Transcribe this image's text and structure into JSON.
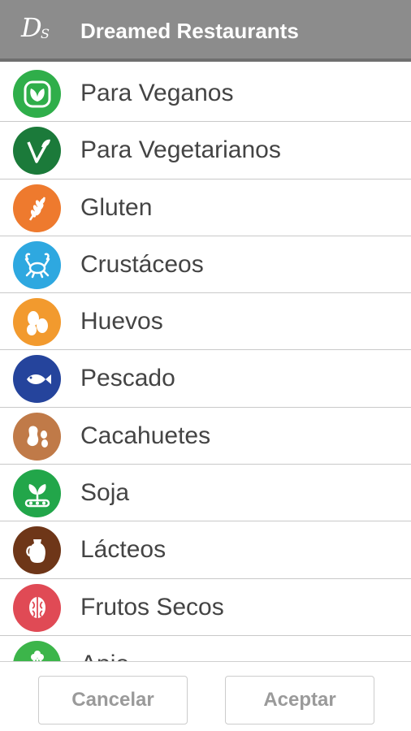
{
  "app": {
    "logo_d": "D",
    "logo_s": "S",
    "title": "Dreamed Restaurants"
  },
  "items": [
    {
      "label": "Para Veganos",
      "icon": "vegan-leaf-icon",
      "color": "#2fae4a"
    },
    {
      "label": "Para Vegetarianos",
      "icon": "vegetarian-v-icon",
      "color": "#1b7a3a"
    },
    {
      "label": "Gluten",
      "icon": "wheat-icon",
      "color": "#ee7a2e"
    },
    {
      "label": "Crustáceos",
      "icon": "crab-icon",
      "color": "#2ea8e0"
    },
    {
      "label": "Huevos",
      "icon": "eggs-icon",
      "color": "#f29a2e"
    },
    {
      "label": "Pescado",
      "icon": "fish-icon",
      "color": "#25449c"
    },
    {
      "label": "Cacahuetes",
      "icon": "peanut-icon",
      "color": "#c07a48"
    },
    {
      "label": "Soja",
      "icon": "soy-icon",
      "color": "#22a64a"
    },
    {
      "label": "Lácteos",
      "icon": "milk-jug-icon",
      "color": "#6e3618"
    },
    {
      "label": "Frutos Secos",
      "icon": "walnut-icon",
      "color": "#e04a55"
    },
    {
      "label": "Apio",
      "icon": "celery-icon",
      "color": "#3cb54a"
    }
  ],
  "footer": {
    "cancel_label": "Cancelar",
    "accept_label": "Aceptar"
  }
}
